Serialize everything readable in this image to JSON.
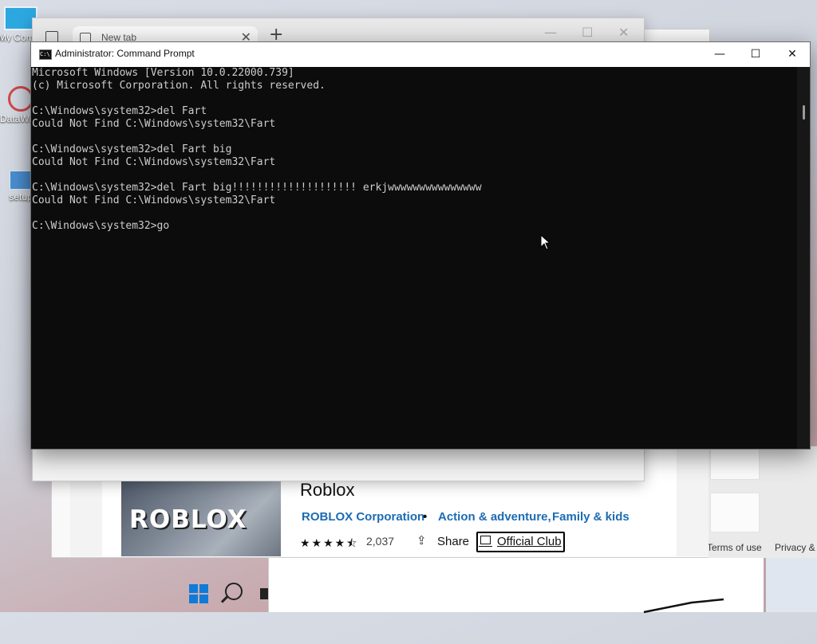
{
  "desktop": {
    "icons": [
      {
        "label": "My Computer"
      },
      {
        "label": "DataWizard"
      },
      {
        "label": "setup"
      }
    ]
  },
  "browser": {
    "tab_title": "New tab",
    "new_tab_symbol": "+",
    "tab_close_symbol": "✕",
    "minimize_symbol": "—",
    "maximize_symbol": "☐",
    "close_symbol": "✕"
  },
  "cmd": {
    "title": "Administrator: Command Prompt",
    "icon_text": "C:\\",
    "minimize_symbol": "—",
    "maximize_symbol": "☐",
    "close_symbol": "✕",
    "lines": [
      "Microsoft Windows [Version 10.0.22000.739]",
      "(c) Microsoft Corporation. All rights reserved.",
      "",
      "C:\\Windows\\system32>del Fart",
      "Could Not Find C:\\Windows\\system32\\Fart",
      "",
      "C:\\Windows\\system32>del Fart big",
      "Could Not Find C:\\Windows\\system32\\Fart",
      "",
      "C:\\Windows\\system32>del Fart big!!!!!!!!!!!!!!!!!!!! erkjwwwwwwwwwwwwwww",
      "Could Not Find C:\\Windows\\system32\\Fart",
      "",
      "C:\\Windows\\system32>go"
    ]
  },
  "store": {
    "app_name": "Roblox",
    "thumbnail_text": "ROBLOX",
    "publisher": "ROBLOX Corporation",
    "separator": "•",
    "categories": "Action & adventure,",
    "categories2": "Family & kids",
    "stars": "★★★★⯪",
    "rating_value": 4.5,
    "rating_count": "2,037",
    "share_label": "Share",
    "share_icon_glyph": "⇪",
    "club_label": "Official Club",
    "footer_terms": "Terms of use",
    "footer_privacy": "Privacy &",
    "accent_color": "#1b6cb3"
  }
}
